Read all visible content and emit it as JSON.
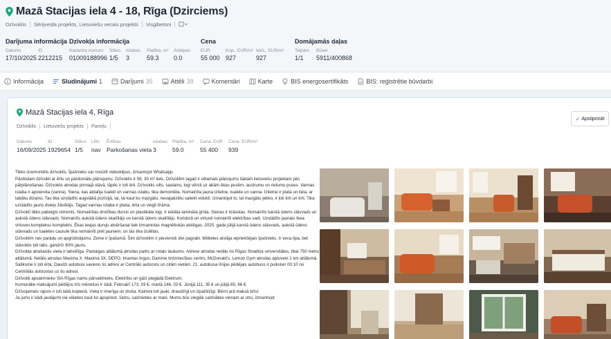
{
  "header": {
    "title": "Mazā Stacijas iela 4 - 18, Rīga (Dzirciems)",
    "tags": [
      "Dzīvoklis",
      "Sērijveida projekts, Lietuviešu vecais projekts",
      "Visgibetoni"
    ],
    "groups": [
      {
        "title": "Darījuma informācija",
        "fields": [
          {
            "label": "Datums",
            "value": "17/10/2025"
          },
          {
            "label": "ID",
            "value": "2212215"
          }
        ]
      },
      {
        "title": "Dzīvokļa informācija",
        "fields": [
          {
            "label": "Kadastra numurs",
            "value": "01009188996"
          },
          {
            "label": "Stāvs",
            "value": "1/5"
          },
          {
            "label": "Istabas",
            "value": "3"
          },
          {
            "label": "Platība, m²",
            "value": "59.3"
          },
          {
            "label": "Ārtelpas",
            "value": "0.0"
          }
        ]
      },
      {
        "title": "Cena",
        "fields": [
          {
            "label": "EUR",
            "value": "55 000"
          },
          {
            "label": "Kop., EUR/m²",
            "value": "927"
          },
          {
            "label": "Iekš., EUR/m²",
            "value": "927"
          }
        ]
      },
      {
        "title": "Domājamās daļas",
        "fields": [
          {
            "label": "Telpām",
            "value": "1/1"
          },
          {
            "label": "Būvei",
            "value": "5911/400868"
          }
        ]
      }
    ]
  },
  "tabs": [
    {
      "label": "Informācija",
      "count": "",
      "icon": "info-icon"
    },
    {
      "label": "Sludinājumi",
      "count": "1",
      "icon": "listing-icon"
    },
    {
      "label": "Darījumi",
      "count": "35",
      "icon": "deals-icon"
    },
    {
      "label": "Attēli",
      "count": "38",
      "icon": "image-icon"
    },
    {
      "label": "Komentāri",
      "count": "",
      "icon": "comment-icon"
    },
    {
      "label": "Karte",
      "count": "",
      "icon": "map-icon"
    },
    {
      "label": "BIS energosertifikāts",
      "count": "",
      "icon": "bulb-icon"
    },
    {
      "label": "BIS: reģistrētie būvdarbi",
      "count": "",
      "icon": "doc-icon"
    }
  ],
  "listing": {
    "title": "Mazā Stacijas iela 4, Rīga",
    "tags": [
      "Dzīvoklis",
      "Lietuviešu projekts",
      "Paneļu"
    ],
    "confirm_label": "Apstiprināt",
    "fields": [
      {
        "label": "Datums",
        "value": "16/09/2025"
      },
      {
        "label": "ID",
        "value": "1929654"
      },
      {
        "label": "Stāvs",
        "value": "1/5"
      },
      {
        "label": "Lifts",
        "value": "nav"
      },
      {
        "label": "Ērtības",
        "value": "Parkošanas vieta"
      },
      {
        "label": "Istabas",
        "value": "3"
      },
      {
        "label": "Platība, m²",
        "value": "59.0"
      },
      {
        "label": "Cena, EUR",
        "value": "55 400"
      },
      {
        "label": "Cena, EUR/m²",
        "value": "939"
      }
    ],
    "description": [
      "Tikko izremontēts dzīvoklis. Īpašnieks var nosūtīt videoklipus, izmantojot Whatsapp.",
      "Pārdodam dzīvokli ar ērtu un pārdomātu plānojumu. Dzīvoklis ir 59, 30 m² liels. Dzīvoklim tagad ir vēlamais plānojums šādam lietuviešu projektam pēc pārplānošanas. Dzīvoklis atrodas pirmajā stāvā, tāpēc ir ļoti ērti. Dzīvoklis silts, saulains, logi vērsti uz abām ēkas pusēm, austrumu un rietumu puses. Vannas istaba ir apvienota (vanna). Siena, kas atdalīja tualeti un vannas istabu, tika demontēta. Nomainīta jauna izlietne, tualete un vanna. Izlietne ir plata un liela, ar labāku dizainu. Tas tika uzstādīts augstākā pozīcijā, lai, lai kaut ko mazgātu, nevajadzētu saliekt viduklī. Izmantojot to, lai mazgātu jebko, ir ļoti ērti un ērti. Tika uzstādīts jauns dvieļu žāvētājs. Tagad vannas istaba ir plaša, ērta un viegli tīrāma.",
      "Dzīvoklī tikko pabeigts remonts. Nomainītas drošības durvis un plastikāta logi. Ir ieklāta lamināta grīda. Sienas ir krāsotas. Nomainīts karstā ūdens stāvvads un aukstā ūdens stāvvads. Nomainīts aukstā ūdens skaitītājs un karstā ūdens skaitītājs. Koridorā un virtuvē nomainīti elektrības vadi. Uzstādīts jaunais Ikea virtuves komplekss komplekts. Ēkas ieejas durvju atvēršanai tiek izmantotas magnētiskās atslēgas. 2025. gada jūlijā karstā ūdens stāvvads, aukstā ūdens stāvvads un tualetes caurule tika nomainīti pret jauniem, un tās tika izolētas.",
      "Dzīvoklim nav parādu un apgrūtinājumu. Zeme ir īpašumā. Šim dzīvoklim ir pievienoti divi pagrabi. Mēbeles atstāja iepriekšējais īpašnieks. Ir veca tipa, bet stāvoklis ļoti labs, gandrīz 80% jauns.",
      "Dzīvokļa atrašanās vieta ir labvēlīga. Pastaigas attālumā atrodas parks ar rotaļu laukumu. Adrese atrodas netālu no Rīgas Stradiņa universitātes, tikai 750 metru attālumā. Netālu atrodas Maxima X. Maxima 3X, DEPO, Imantas tirgus, Damme tirdzniecības centrs, McDonald's, Lemon Gym atrodas aptuveni 1 km attālumā. Satiksme ir ļoti ērta. Daudzi autobusi savieno šo adresi ar Centrālo autoostu un citām vietām. 21. autobusa līnijas pēdējais autobuss ir pulksten 00:10 no Centrālās autoostas uz šo adresi.",
      "Dzīvokļi apsaimnieko SIA Rīgas namu pārvaldnieks. Elektrību un gāzi piegādā Elektrum.",
      "Komunālie maksājumi pēdējos trīs mēnešos ir šādi. Februārī 173, 03 €, martā 146, 03 €. Jūnijā 111, 35 € un jūlijā 85, 66 €.",
      "Dzīvojamais rajons ir ļoti labā kopienā. Vieta ir mierīga un droša. Kaimiņi ļoti jauki, draudzīgi un izpalīdzīgi. Bērni arā maksā brīvi.",
      "Ja jums ir kādi jautājumi vai vēlaties kaut ko apspriest, lūdzu, sazinieties ar mani. Mums būs viegļāk sazināties vienam ar otru, izmantojot"
    ],
    "photos": [
      "bathroom-photo",
      "living-room-photo",
      "living-room-photo",
      "living-room-photo",
      "bedroom-photo",
      "living-room-photo",
      "kitchen-photo",
      "bedroom-photo",
      "hallway-photo",
      "hallway-photo",
      "window-photo",
      "living-room-photo"
    ]
  },
  "colors": {
    "accent": "#3d7fd9",
    "pin": "#19a974"
  }
}
